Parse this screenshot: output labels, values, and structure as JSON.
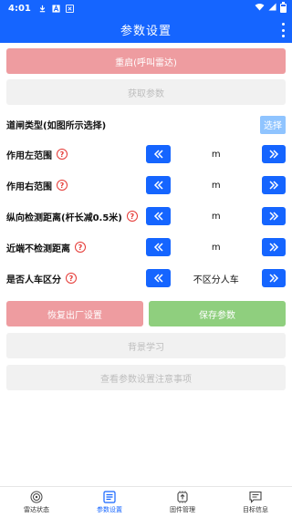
{
  "status_bar": {
    "time": "4:01"
  },
  "app_bar": {
    "title": "参数设置"
  },
  "buttons": {
    "restart": "重启(呼叫雷达)",
    "fetch": "获取参数",
    "reset": "恢复出厂设置",
    "save": "保存参数",
    "background_learn": "背景学习",
    "view_notes": "查看参数设置注意事项"
  },
  "gate_type": {
    "label": "道闸类型(如图所示选择)",
    "select_label": "选择"
  },
  "params": [
    {
      "label": "作用左范围",
      "help": "?",
      "value": "m"
    },
    {
      "label": "作用右范围",
      "help": "?",
      "value": "m"
    },
    {
      "label": "纵向检测距离(杆长减0.5米)",
      "help": "?",
      "value": "m"
    },
    {
      "label": "近端不检测距离",
      "help": "?",
      "value": "m"
    },
    {
      "label": "是否人车区分",
      "help": "?",
      "value": "不区分人车"
    }
  ],
  "bottom_nav": [
    {
      "label": "雷达状态",
      "icon": "radar-icon",
      "active": false
    },
    {
      "label": "参数设置",
      "icon": "settings-list-icon",
      "active": true
    },
    {
      "label": "固件管理",
      "icon": "firmware-icon",
      "active": false
    },
    {
      "label": "目标信息",
      "icon": "message-icon",
      "active": false
    }
  ],
  "colors": {
    "primary": "#1565ff",
    "restart_bg": "#ee9ca0",
    "save_bg": "#8fcf7e",
    "select_bg": "#8fc4ff",
    "help_red": "#e53935"
  }
}
